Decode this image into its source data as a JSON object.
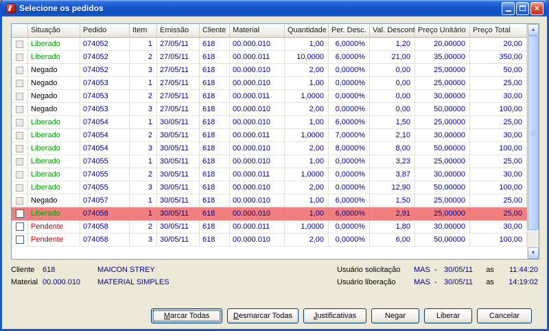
{
  "colors": {
    "data_text": "#000090",
    "status_liberado": "#00A000",
    "status_negado": "#000000",
    "status_pendente": "#CC0000",
    "highlight_row": "#F08080"
  },
  "window": {
    "title": "Selecione os pedidos"
  },
  "table": {
    "columns": [
      "Situação",
      "Pedido",
      "Item",
      "Emissão",
      "Cliente",
      "Material",
      "Quantidade",
      "Per. Desc.",
      "Val. Desconto",
      "Preço Unitário",
      "Preço Total"
    ],
    "rows": [
      {
        "status": "liberado",
        "situacao": "Liberado",
        "checkbox": "flat",
        "highlighted": false,
        "pedido": "074052",
        "item": "1",
        "emissao": "27/05/11",
        "cliente": "618",
        "material": "00.000.010",
        "quantidade": "1,00",
        "per_desc": "6,0000%",
        "val_desconto": "1,20",
        "preco_unitario": "20,00000",
        "preco_total": "20,00"
      },
      {
        "status": "liberado",
        "situacao": "Liberado",
        "checkbox": "flat",
        "highlighted": false,
        "pedido": "074052",
        "item": "2",
        "emissao": "27/05/11",
        "cliente": "618",
        "material": "00.000.011",
        "quantidade": "10,0000",
        "per_desc": "6,0000%",
        "val_desconto": "21,00",
        "preco_unitario": "35,00000",
        "preco_total": "350,00"
      },
      {
        "status": "negado",
        "situacao": "Negado",
        "checkbox": "flat",
        "highlighted": false,
        "pedido": "074052",
        "item": "3",
        "emissao": "27/05/11",
        "cliente": "618",
        "material": "00.000.010",
        "quantidade": "2,00",
        "per_desc": "0,0000%",
        "val_desconto": "0,00",
        "preco_unitario": "25,00000",
        "preco_total": "50,00"
      },
      {
        "status": "negado",
        "situacao": "Negado",
        "checkbox": "flat",
        "highlighted": false,
        "pedido": "074053",
        "item": "1",
        "emissao": "27/05/11",
        "cliente": "618",
        "material": "00.000.010",
        "quantidade": "1,00",
        "per_desc": "0,0000%",
        "val_desconto": "0,00",
        "preco_unitario": "25,00000",
        "preco_total": "25,00"
      },
      {
        "status": "negado",
        "situacao": "Negado",
        "checkbox": "flat",
        "highlighted": false,
        "pedido": "074053",
        "item": "2",
        "emissao": "27/05/11",
        "cliente": "618",
        "material": "00.000.011",
        "quantidade": "1,0000",
        "per_desc": "0,0000%",
        "val_desconto": "0,00",
        "preco_unitario": "30,00000",
        "preco_total": "30,00"
      },
      {
        "status": "negado",
        "situacao": "Negado",
        "checkbox": "flat",
        "highlighted": false,
        "pedido": "074053",
        "item": "3",
        "emissao": "27/05/11",
        "cliente": "618",
        "material": "00.000.010",
        "quantidade": "2,00",
        "per_desc": "0,0000%",
        "val_desconto": "0,00",
        "preco_unitario": "50,00000",
        "preco_total": "100,00"
      },
      {
        "status": "liberado",
        "situacao": "Liberado",
        "checkbox": "flat",
        "highlighted": false,
        "pedido": "074054",
        "item": "1",
        "emissao": "30/05/11",
        "cliente": "618",
        "material": "00.000.010",
        "quantidade": "1,00",
        "per_desc": "6,0000%",
        "val_desconto": "1,50",
        "preco_unitario": "25,00000",
        "preco_total": "25,00"
      },
      {
        "status": "liberado",
        "situacao": "Liberado",
        "checkbox": "flat",
        "highlighted": false,
        "pedido": "074054",
        "item": "2",
        "emissao": "30/05/11",
        "cliente": "618",
        "material": "00.000.011",
        "quantidade": "1,0000",
        "per_desc": "7,0000%",
        "val_desconto": "2,10",
        "preco_unitario": "30,00000",
        "preco_total": "30,00"
      },
      {
        "status": "liberado",
        "situacao": "Liberado",
        "checkbox": "flat",
        "highlighted": false,
        "pedido": "074054",
        "item": "3",
        "emissao": "30/05/11",
        "cliente": "618",
        "material": "00.000.010",
        "quantidade": "2,00",
        "per_desc": "8,0000%",
        "val_desconto": "8,00",
        "preco_unitario": "50,00000",
        "preco_total": "100,00"
      },
      {
        "status": "liberado",
        "situacao": "Liberado",
        "checkbox": "flat",
        "highlighted": false,
        "pedido": "074055",
        "item": "1",
        "emissao": "30/05/11",
        "cliente": "618",
        "material": "00.000.010",
        "quantidade": "1,00",
        "per_desc": "0,0000%",
        "val_desconto": "3,23",
        "preco_unitario": "25,00000",
        "preco_total": "25,00"
      },
      {
        "status": "liberado",
        "situacao": "Liberado",
        "checkbox": "flat",
        "highlighted": false,
        "pedido": "074055",
        "item": "2",
        "emissao": "30/05/11",
        "cliente": "618",
        "material": "00.000.011",
        "quantidade": "1,0000",
        "per_desc": "0,0000%",
        "val_desconto": "3,87",
        "preco_unitario": "30,00000",
        "preco_total": "30,00"
      },
      {
        "status": "liberado",
        "situacao": "Liberado",
        "checkbox": "flat",
        "highlighted": false,
        "pedido": "074055",
        "item": "3",
        "emissao": "30/05/11",
        "cliente": "618",
        "material": "00.000.010",
        "quantidade": "2,00",
        "per_desc": "0,0000%",
        "val_desconto": "12,90",
        "preco_unitario": "50,00000",
        "preco_total": "100,00"
      },
      {
        "status": "negado",
        "situacao": "Negado",
        "checkbox": "flat",
        "highlighted": false,
        "pedido": "074057",
        "item": "1",
        "emissao": "30/05/11",
        "cliente": "618",
        "material": "00.000.010",
        "quantidade": "1,00",
        "per_desc": "6,0000%",
        "val_desconto": "1,50",
        "preco_unitario": "25,00000",
        "preco_total": "25,00"
      },
      {
        "status": "liberado",
        "situacao": "Liberado",
        "checkbox": "enabled",
        "highlighted": true,
        "pedido": "074058",
        "item": "1",
        "emissao": "30/05/11",
        "cliente": "618",
        "material": "00.000.010",
        "quantidade": "1,00",
        "per_desc": "6,0000%",
        "val_desconto": "2,91",
        "preco_unitario": "25,00000",
        "preco_total": "25,00"
      },
      {
        "status": "pendente",
        "situacao": "Pendente",
        "checkbox": "enabled",
        "highlighted": false,
        "pedido": "074058",
        "item": "2",
        "emissao": "30/05/11",
        "cliente": "618",
        "material": "00.000.011",
        "quantidade": "1,0000",
        "per_desc": "0,0000%",
        "val_desconto": "1,80",
        "preco_unitario": "30,00000",
        "preco_total": "30,00"
      },
      {
        "status": "pendente",
        "situacao": "Pendente",
        "checkbox": "enabled",
        "highlighted": false,
        "pedido": "074058",
        "item": "3",
        "emissao": "30/05/11",
        "cliente": "618",
        "material": "00.000.010",
        "quantidade": "2,00",
        "per_desc": "0,0000%",
        "val_desconto": "6,00",
        "preco_unitario": "50,00000",
        "preco_total": "100,00"
      }
    ]
  },
  "footer": {
    "cliente_label": "Cliente",
    "cliente_value": "618",
    "cliente_name": "MAICON STREY",
    "material_label": "Material",
    "material_value": "00.000.010",
    "material_name": "MATERIAL SIMPLES",
    "solicitacao_label": "Usuário solicitação",
    "solicitacao_user": "MAS",
    "solicitacao_sep": "-",
    "solicitacao_date": "30/05/11",
    "solicitacao_as": "as",
    "solicitacao_time": "11:44:20",
    "liberacao_label": "Usuário liberação",
    "liberacao_user": "MAS",
    "liberacao_sep": "-",
    "liberacao_date": "30/05/11",
    "liberacao_as": "as",
    "liberacao_time": "14:19:02"
  },
  "buttons": [
    {
      "id": "marcar-todas",
      "label": "Marcar Todas",
      "accel": "M",
      "focused": true
    },
    {
      "id": "desmarcar-todas",
      "label": "Desmarcar Todas",
      "accel": "D",
      "focused": false
    },
    {
      "id": "justificativas",
      "label": "Justificativas",
      "accel": "J",
      "focused": false
    },
    {
      "id": "negar",
      "label": "Negar",
      "accel": "",
      "focused": false
    },
    {
      "id": "liberar",
      "label": "Liberar",
      "accel": "",
      "focused": false
    },
    {
      "id": "cancelar",
      "label": "Cancelar",
      "accel": "",
      "focused": false
    }
  ]
}
